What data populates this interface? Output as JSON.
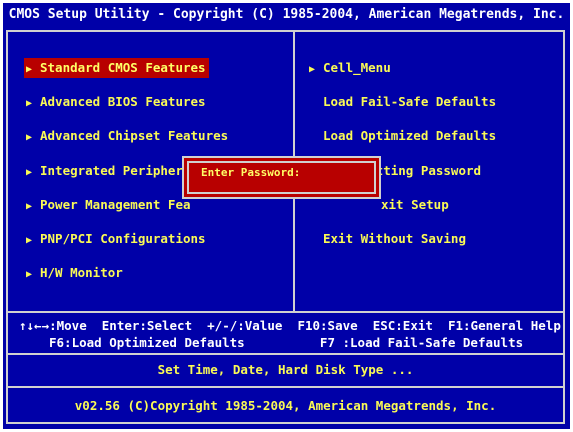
{
  "window": {
    "title": "CMOS Setup Utility - Copyright (C) 1985-2004, American Megatrends, Inc."
  },
  "left_menu": [
    {
      "label": "Standard CMOS Features",
      "arrow": "▶",
      "selected": true
    },
    {
      "label": "Advanced BIOS Features",
      "arrow": "▶"
    },
    {
      "label": "Advanced Chipset Features",
      "arrow": "▶"
    },
    {
      "label": "Integrated Peripherals",
      "arrow": "▶"
    },
    {
      "label": "Power Management Fea",
      "arrow": "▶"
    },
    {
      "label": "PNP/PCI Configurations",
      "arrow": "▶"
    },
    {
      "label": "H/W Monitor",
      "arrow": "▶"
    }
  ],
  "right_menu": [
    {
      "label": "Cell_Menu",
      "arrow": "▶"
    },
    {
      "label": "Load Fail-Safe Defaults"
    },
    {
      "label": "Load Optimized Defaults"
    },
    {
      "label": "BIOS Setting Password"
    },
    {
      "label": "xit Setup"
    },
    {
      "label": "Exit Without Saving"
    }
  ],
  "help": {
    "line1": "↑↓←→:Move  Enter:Select  +/-/:Value  F10:Save  ESC:Exit  F1:General Help",
    "line2": "F6:Load Optimized Defaults          F7 :Load Fail-Safe Defaults"
  },
  "status_text": "Set Time, Date, Hard Disk Type ...",
  "copyright": "v02.56 (C)Copyright 1985-2004, American Megatrends, Inc.",
  "dialog": {
    "label": "Enter Password:"
  },
  "colors": {
    "background": "#0000a8",
    "text_yellow": "#fafa55",
    "selection": "#b80000",
    "border": "#d0d0d0"
  }
}
